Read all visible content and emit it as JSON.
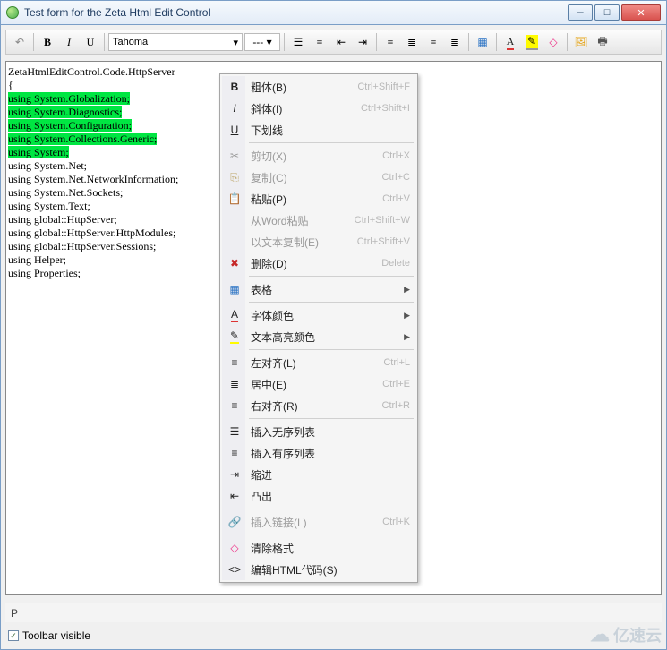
{
  "window": {
    "title": "Test form for the Zeta Html Edit Control"
  },
  "toolbar": {
    "font": "Tahoma",
    "dash": "---"
  },
  "editor": {
    "line0": "ZetaHtmlEditControl.Code.HttpServer",
    "line1": "{",
    "hl": [
      "using System.Globalization;",
      "using System.Diagnostics;",
      "using System.Configuration;",
      "using System.Collections.Generic;",
      "using System;"
    ],
    "plain": [
      "using System.Net;",
      "using System.Net.NetworkInformation;",
      "using System.Net.Sockets;",
      "using System.Text;",
      "using global::HttpServer;",
      "using global::HttpServer.HttpModules;",
      "using global::HttpServer.Sessions;",
      "using Helper;",
      "using Properties;"
    ]
  },
  "menu": {
    "bold": {
      "label": "粗体(B)",
      "shortcut": "Ctrl+Shift+F"
    },
    "italic": {
      "label": "斜体(I)",
      "shortcut": "Ctrl+Shift+I"
    },
    "underline": {
      "label": "下划线"
    },
    "cut": {
      "label": "剪切(X)",
      "shortcut": "Ctrl+X"
    },
    "copy": {
      "label": "复制(C)",
      "shortcut": "Ctrl+C"
    },
    "paste": {
      "label": "粘贴(P)",
      "shortcut": "Ctrl+V"
    },
    "pasteword": {
      "label": "从Word粘贴",
      "shortcut": "Ctrl+Shift+W"
    },
    "copytext": {
      "label": "以文本复制(E)",
      "shortcut": "Ctrl+Shift+V"
    },
    "delete": {
      "label": "删除(D)",
      "shortcut": "Delete"
    },
    "table": {
      "label": "表格"
    },
    "fontcolor": {
      "label": "字体颜色"
    },
    "hilite": {
      "label": "文本高亮颜色"
    },
    "alignl": {
      "label": "左对齐(L)",
      "shortcut": "Ctrl+L"
    },
    "alignc": {
      "label": "居中(E)",
      "shortcut": "Ctrl+E"
    },
    "alignr": {
      "label": "右对齐(R)",
      "shortcut": "Ctrl+R"
    },
    "ul": {
      "label": "插入无序列表"
    },
    "ol": {
      "label": "插入有序列表"
    },
    "indent": {
      "label": "缩进"
    },
    "outdent": {
      "label": "凸出"
    },
    "link": {
      "label": "插入链接(L)",
      "shortcut": "Ctrl+K"
    },
    "clear": {
      "label": "清除格式"
    },
    "html": {
      "label": "编辑HTML代码(S)"
    }
  },
  "status": {
    "path": "P"
  },
  "checkbox": {
    "label": "Toolbar visible",
    "checked": true
  },
  "watermark": "亿速云"
}
